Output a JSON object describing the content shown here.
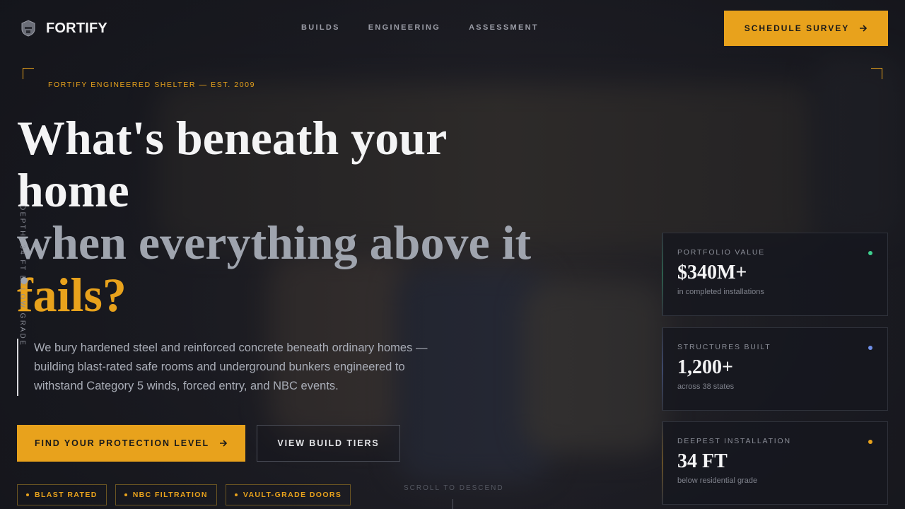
{
  "brand": {
    "name": "FORTIFY",
    "logo_icon": "shield-helmet-icon"
  },
  "nav": {
    "items": [
      "BUILDS",
      "ENGINEERING",
      "ASSESSMENT"
    ]
  },
  "header_cta": {
    "label": "SCHEDULE SURVEY",
    "icon": "arrow-right-icon"
  },
  "hero": {
    "eyebrow": "FORTIFY ENGINEERED SHELTER — EST. 2009",
    "headline_line1": "What's beneath your home",
    "headline_line2_a": "when everything above it ",
    "headline_line2_accent": "fails?",
    "depth_label": "DEPTH: 34 FT BELOW GRADE",
    "subtext": "We bury hardened steel and reinforced concrete beneath ordinary homes — building blast-rated safe rooms and underground bunkers engineered to withstand Category 5 winds, forced entry, and NBC events.",
    "primary_cta": "FIND YOUR PROTECTION LEVEL",
    "secondary_cta": "VIEW BUILD TIERS",
    "badges": [
      "BLAST RATED",
      "NBC FILTRATION",
      "VAULT-GRADE DOORS"
    ],
    "scroll_hint": "SCROLL TO DESCEND"
  },
  "stats": [
    {
      "label": "PORTFOLIO VALUE",
      "value": "$340M+",
      "note": "in completed installations",
      "dot_color": "#3ecf8e"
    },
    {
      "label": "STRUCTURES BUILT",
      "value": "1,200+",
      "note": "across 38 states",
      "dot_color": "#6f8fe8"
    },
    {
      "label": "DEEPEST INSTALLATION",
      "value": "34 FT",
      "note": "below residential grade",
      "dot_color": "#e8a21c"
    }
  ],
  "colors": {
    "accent": "#e8a21c",
    "background": "#16171d"
  }
}
